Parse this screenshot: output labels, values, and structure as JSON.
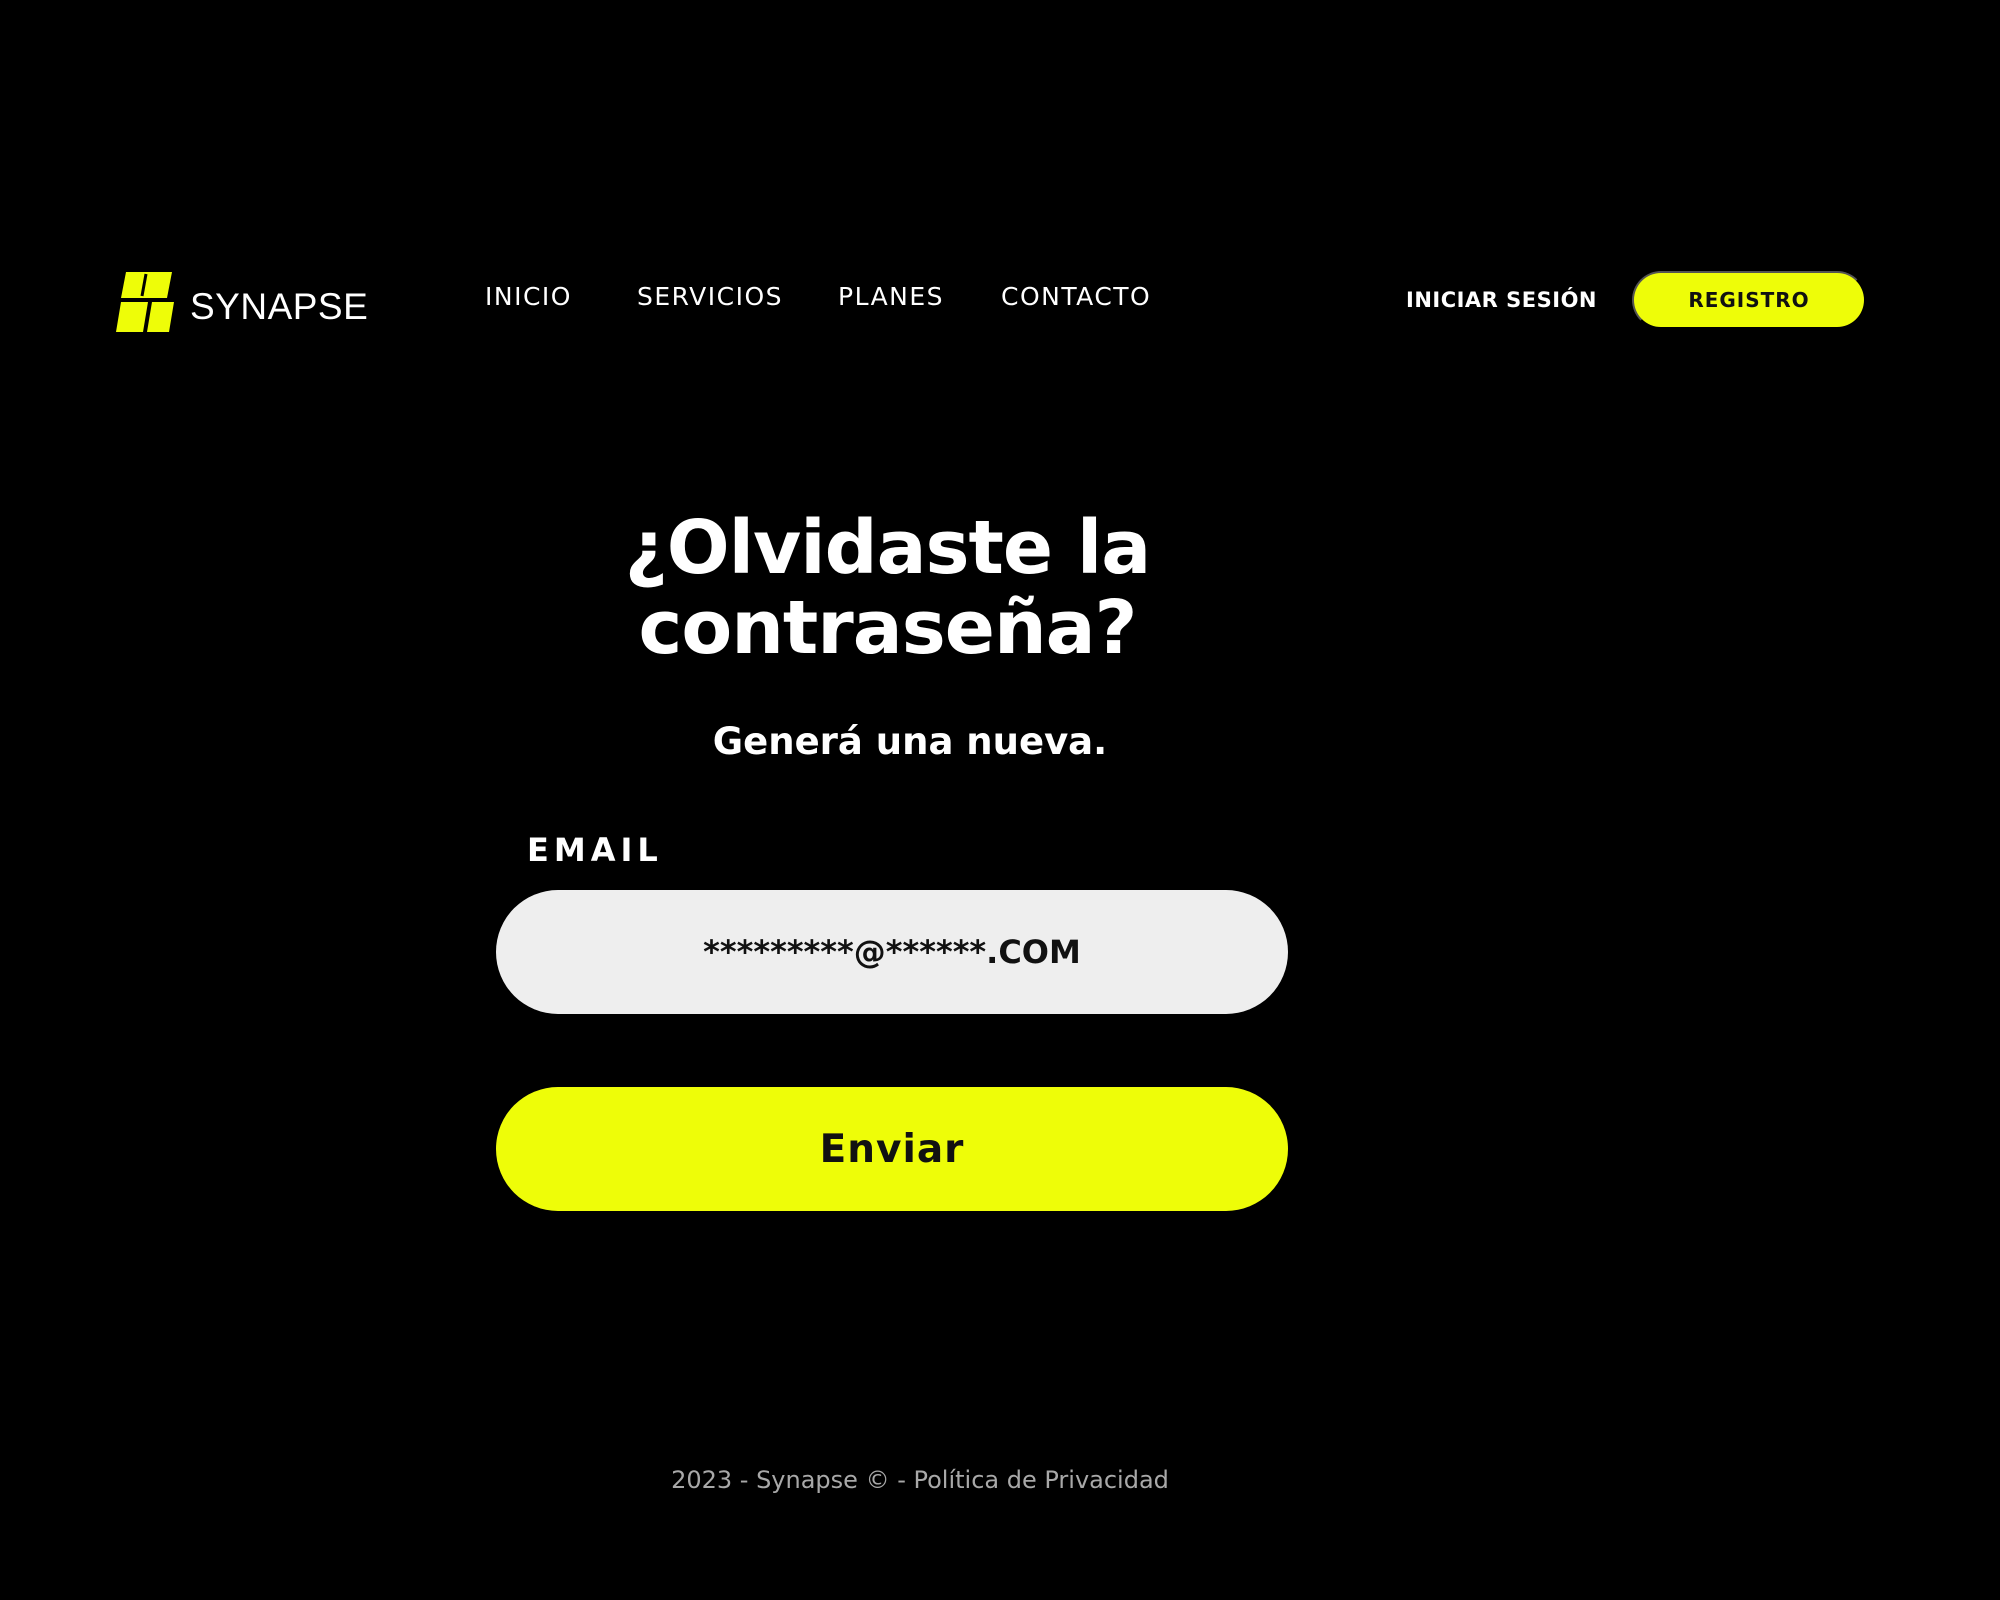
{
  "brand": {
    "name": "SYNAPSE",
    "icon": "synapse-logo-icon",
    "accent_color": "#eefd08"
  },
  "nav": {
    "items": [
      {
        "label": "INICIO"
      },
      {
        "label": "SERVICIOS"
      },
      {
        "label": "PLANES"
      },
      {
        "label": "CONTACTO"
      }
    ]
  },
  "auth": {
    "login_label": "INICIAR SESIÓN",
    "register_label": "REGISTRO"
  },
  "main": {
    "title": "¿Olvidaste la contraseña?",
    "subtitle": "Generá una nueva.",
    "email_label": "EMAIL",
    "email_value": "*********@******.COM",
    "submit_label": "Enviar"
  },
  "footer": {
    "prefix": "2023 - Synapse © - ",
    "privacy_link": "Política de Privacidad",
    "text_color": "#a8a8a8"
  },
  "colors": {
    "background": "#000000",
    "input_background": "#eeeeee"
  }
}
